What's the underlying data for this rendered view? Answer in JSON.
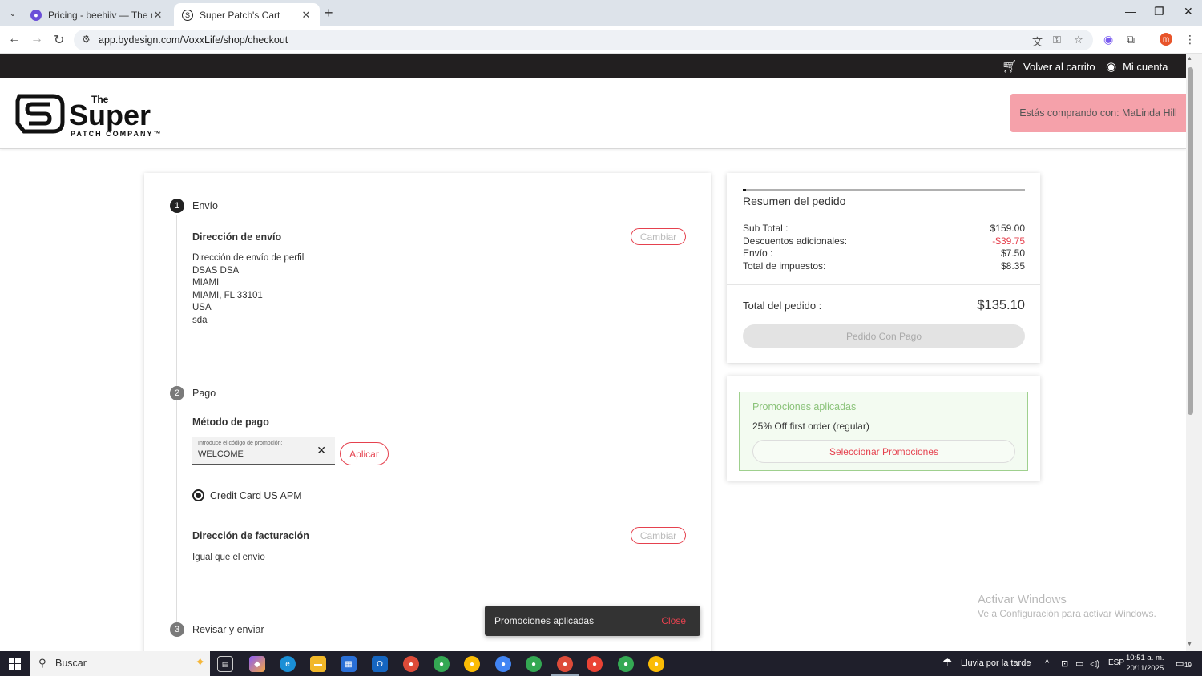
{
  "browser": {
    "tabs": [
      {
        "title": "Pricing - beehiiv — The newslet",
        "active": false
      },
      {
        "title": "Super Patch's Cart",
        "active": true
      }
    ],
    "url": "app.bydesign.com/VoxxLife/shop/checkout",
    "profile_initial": "m"
  },
  "site": {
    "topbar": {
      "cart_label": "Volver al carrito",
      "account_label": "Mi cuenta"
    },
    "logo": {
      "line1": "The",
      "line2": "Super",
      "line3": "PATCH COMPANY™"
    },
    "shopping_with": "Estás comprando con: MaLinda Hill"
  },
  "checkout": {
    "steps": [
      {
        "number": "1",
        "title": "Envío"
      },
      {
        "number": "2",
        "title": "Pago"
      },
      {
        "number": "3",
        "title": "Revisar y enviar"
      }
    ],
    "shipping": {
      "section_title": "Dirección de envío",
      "change_label": "Cambiar",
      "lines": [
        "Dirección de envío de perfil",
        "DSAS DSA",
        "MIAMI",
        "MIAMI, FL 33101",
        "USA",
        "sda"
      ]
    },
    "payment": {
      "section_title": "Método de pago",
      "promo_label": "Introduce el código de promoción:",
      "promo_value": "WELCOME",
      "apply_label": "Aplicar",
      "method": "Credit Card US APM"
    },
    "billing": {
      "section_title": "Dirección de facturación",
      "change_label": "Cambiar",
      "text": "Igual que el envío"
    }
  },
  "summary": {
    "title": "Resumen del pedido",
    "rows": [
      {
        "label": "Sub Total :",
        "value": "$159.00",
        "color": "#333333"
      },
      {
        "label": "Descuentos adicionales:",
        "value": "-$39.75",
        "color": "#e5414e"
      },
      {
        "label": "Envío :",
        "value": "$7.50",
        "color": "#333333"
      },
      {
        "label": "Total de impuestos:",
        "value": "$8.35",
        "color": "#333333"
      }
    ],
    "total_label": "Total del pedido :",
    "total_value": "$135.10",
    "place_order_label": "Pedido Con Pago"
  },
  "promotions": {
    "title": "Promociones aplicadas",
    "item": "25% Off first order (regular)",
    "select_label": "Seleccionar Promociones"
  },
  "snackbar": {
    "message": "Promociones aplicadas",
    "action": "Close"
  },
  "watermark": {
    "line1": "Activar Windows",
    "line2": "Ve a Configuración para activar Windows."
  },
  "taskbar": {
    "search_placeholder": "Buscar",
    "weather": "Lluvia por la tarde",
    "language": "ESP",
    "time": "10:51 a. m.",
    "date": "20/11/2025",
    "notifications": "19"
  },
  "colors": {
    "accent": "#e5414e",
    "promo_green": "#8bc37a",
    "topbar": "#221f20",
    "shopping_with_bg": "#f5a1aa"
  }
}
